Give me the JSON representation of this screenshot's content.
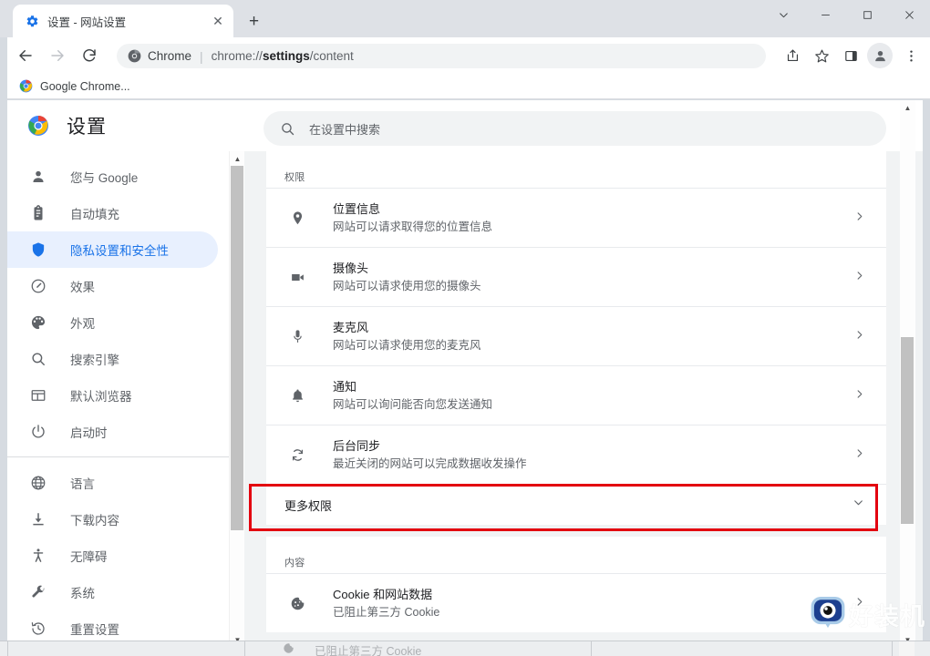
{
  "window": {
    "controls": [
      {
        "name": "tab-search",
        "glyph": "⌄"
      },
      {
        "name": "minimize",
        "glyph": "—"
      },
      {
        "name": "maximize",
        "glyph": "▢"
      },
      {
        "name": "close",
        "glyph": "✕"
      }
    ]
  },
  "tab": {
    "title": "设置 - 网站设置",
    "favicon": "settings-gear-icon",
    "close_glyph": "✕",
    "new_tab_glyph": "+"
  },
  "toolbar": {
    "back_glyph": "←",
    "forward_glyph": "→",
    "reload_glyph": "⟳",
    "omnibox": {
      "chip_icon": "chrome-logo-icon",
      "chip_text": "Chrome",
      "separator": "|",
      "url_prefix": "chrome://",
      "url_bold": "settings",
      "url_suffix": "/content"
    },
    "actions": [
      {
        "name": "share-icon",
        "glyph": "share"
      },
      {
        "name": "bookmark-star-icon",
        "glyph": "☆"
      },
      {
        "name": "side-panel-icon",
        "glyph": "panel"
      },
      {
        "name": "profile-avatar",
        "glyph": "person"
      },
      {
        "name": "chrome-menu-icon",
        "glyph": "⋮"
      }
    ]
  },
  "bookmarks": [
    {
      "label": "Google Chrome...",
      "icon": "chrome-logo-icon"
    }
  ],
  "settings": {
    "logo": "chrome-logo-icon",
    "title": "设置",
    "search": {
      "icon": "search-icon",
      "placeholder": "在设置中搜索",
      "value": ""
    }
  },
  "sidebar": {
    "groups": [
      {
        "items": [
          {
            "label": "您与 Google",
            "icon": "person-icon",
            "active": false
          },
          {
            "label": "自动填充",
            "icon": "clipboard-icon",
            "active": false
          },
          {
            "label": "隐私设置和安全性",
            "icon": "shield-icon",
            "active": true
          },
          {
            "label": "效果",
            "icon": "performance-gauge-icon",
            "active": false
          },
          {
            "label": "外观",
            "icon": "palette-icon",
            "active": false
          },
          {
            "label": "搜索引擎",
            "icon": "search-icon",
            "active": false
          },
          {
            "label": "默认浏览器",
            "icon": "browser-window-icon",
            "active": false
          },
          {
            "label": "启动时",
            "icon": "power-icon",
            "active": false
          }
        ]
      },
      {
        "items": [
          {
            "label": "语言",
            "icon": "globe-icon",
            "active": false
          },
          {
            "label": "下载内容",
            "icon": "download-icon",
            "active": false
          },
          {
            "label": "无障碍",
            "icon": "accessibility-icon",
            "active": false
          },
          {
            "label": "系统",
            "icon": "wrench-icon",
            "active": false
          },
          {
            "label": "重置设置",
            "icon": "history-restore-icon",
            "active": false
          }
        ]
      }
    ]
  },
  "main": {
    "permissions_section_title": "权限",
    "permissions": [
      {
        "title": "位置信息",
        "sub": "网站可以请求取得您的位置信息",
        "icon": "location-pin-icon"
      },
      {
        "title": "摄像头",
        "sub": "网站可以请求使用您的摄像头",
        "icon": "camera-icon"
      },
      {
        "title": "麦克风",
        "sub": "网站可以请求使用您的麦克风",
        "icon": "microphone-icon"
      },
      {
        "title": "通知",
        "sub": "网站可以询问能否向您发送通知",
        "icon": "bell-icon"
      },
      {
        "title": "后台同步",
        "sub": "最近关闭的网站可以完成数据收发操作",
        "icon": "sync-icon"
      }
    ],
    "more_permissions": {
      "label": "更多权限",
      "expand_glyph": "⌄",
      "highlighted": true
    },
    "content_section_title": "内容",
    "content_items": [
      {
        "title": "Cookie 和网站数据",
        "sub": "已阻止第三方 Cookie",
        "icon": "cookie-icon"
      }
    ],
    "row_chevron": "›"
  },
  "ghost_strip": {
    "text": "已阻止第三方 Cookie",
    "icon": "cookie-icon"
  },
  "watermark": {
    "text": "好装机",
    "logo": "haozhuangji-mascot-icon"
  },
  "colors": {
    "accent": "#1a73e8",
    "accent_bg": "#e8f0fe",
    "highlight_red": "#e3000f",
    "page_bg": "#f1f3f4",
    "card_bg": "#ffffff",
    "text_primary": "#202124",
    "text_secondary": "#5f6368"
  }
}
